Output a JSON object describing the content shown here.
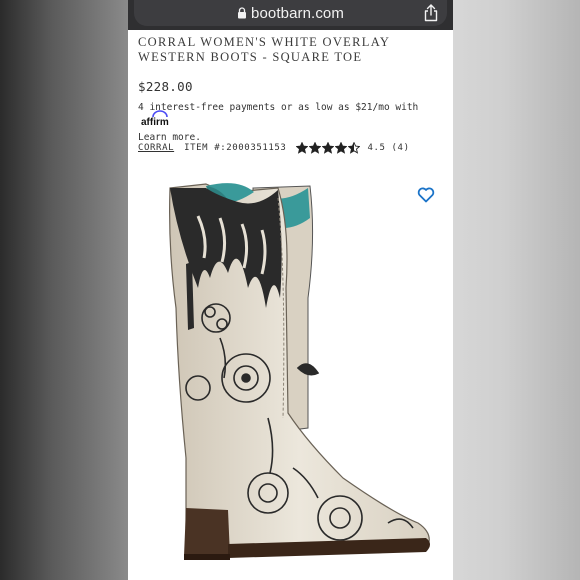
{
  "browser": {
    "url": "bootbarn.com",
    "icons": {
      "lock": "lock-icon",
      "share": "share-icon"
    }
  },
  "product": {
    "title_line1": "CORRAL WOMEN'S WHITE OVERLAY",
    "title_line2": "WESTERN BOOTS - SQUARE TOE",
    "price": "$228.00",
    "payments_text": "4 interest-free payments or as low as $21/mo with",
    "affirm_logo": "affirm",
    "learn_more": "Learn more.",
    "brand": "CORRAL",
    "item_number": "ITEM #:2000351153",
    "rating_value": 4.5,
    "rating_text": "4.5 (4)",
    "stars_total": 5
  },
  "colors": {
    "accent_blue": "#1a73c8",
    "boot_leather": "#e6e0d4",
    "boot_overlay": "#2a2a2a",
    "boot_lining": "#3a9a9a",
    "sole": "#4a3324"
  },
  "icons": {
    "favorite": "heart-icon",
    "star": "star-icon"
  }
}
